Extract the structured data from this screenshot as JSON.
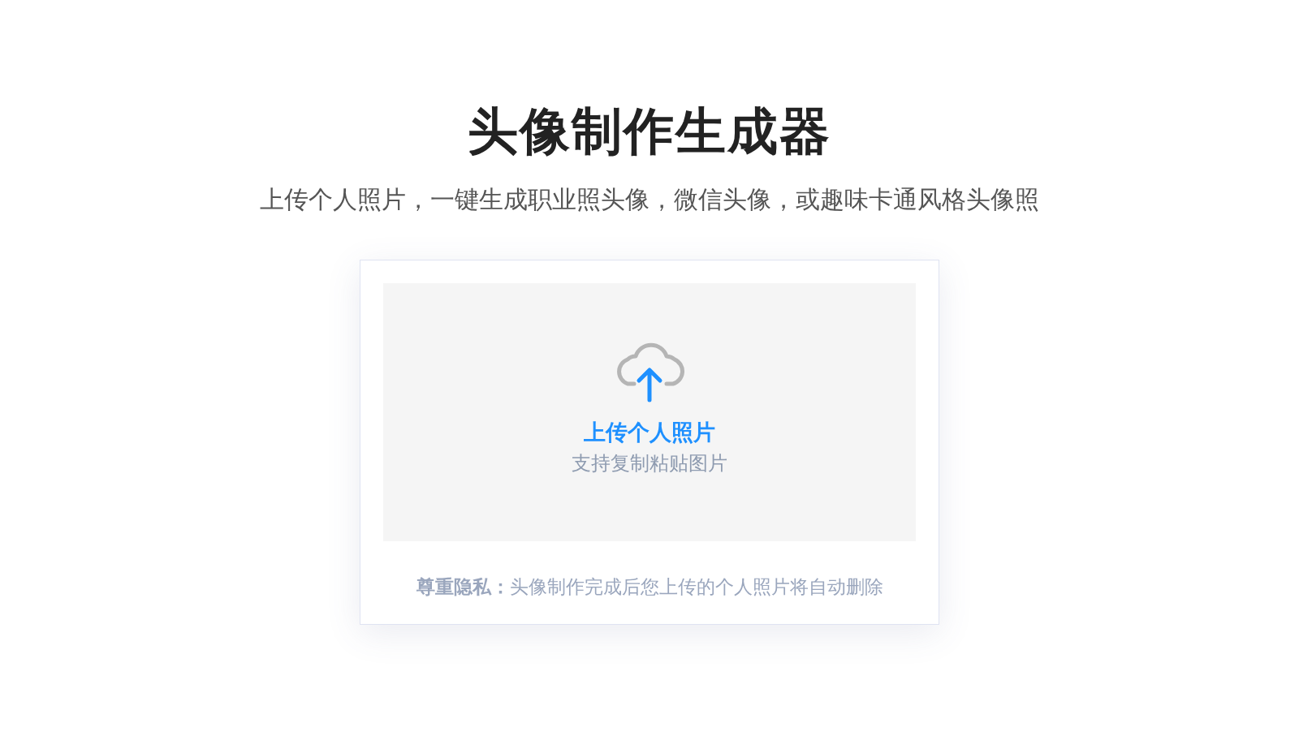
{
  "title": "头像制作生成器",
  "subtitle": "上传个人照片，一键生成职业照头像，微信头像，或趣味卡通风格头像照",
  "upload": {
    "label": "上传个人照片",
    "hint": "支持复制粘贴图片"
  },
  "privacy_note": "**尊重隐私：**头像制作完成后您上传的个人照片将自动删除"
}
